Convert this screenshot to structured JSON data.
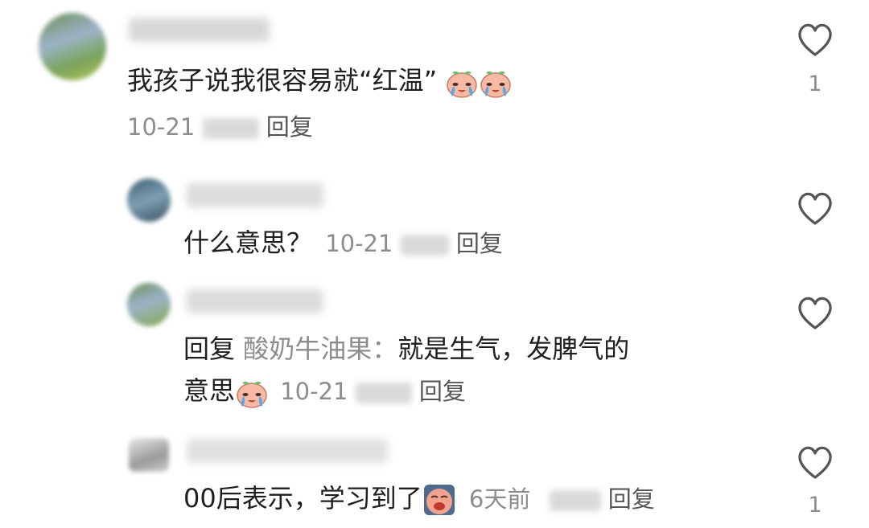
{
  "comments": [
    {
      "text": "我孩子说我很容易就“红温”",
      "date": "10-21",
      "reply_label": "回复",
      "likes": "1",
      "emoji": [
        "crying-peach-icon",
        "crying-peach-icon"
      ]
    },
    {
      "text": "什么意思？",
      "date": "10-21",
      "reply_label": "回复",
      "likes": ""
    },
    {
      "reply_prefix": "回复",
      "mention": "酸奶牛油果：",
      "text_line1": "就是生气，发脾气的",
      "text_line2": "意思",
      "date": "10-21",
      "reply_label": "回复",
      "likes": "",
      "emoji": [
        "crying-peach-icon"
      ]
    },
    {
      "text": "00后表示，学习到了",
      "date": "6天前",
      "reply_label": "回复",
      "likes": "1",
      "emoji": [
        "crying-face-icon"
      ]
    }
  ],
  "colors": {
    "meta_gray": "#8c8c8c",
    "text": "#1f1f1f",
    "heart_stroke": "#555555"
  }
}
